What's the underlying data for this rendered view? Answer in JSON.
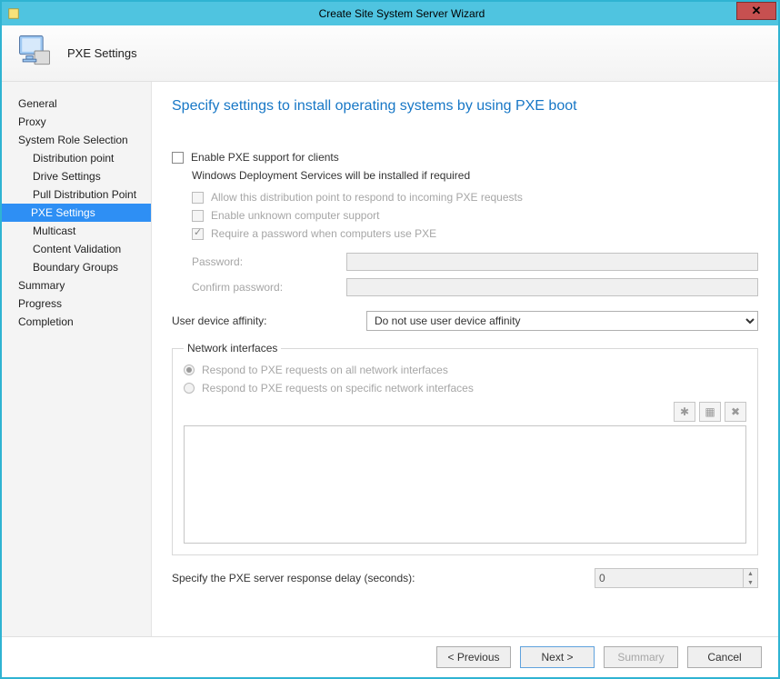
{
  "window": {
    "title": "Create Site System Server Wizard"
  },
  "header": {
    "page_label": "PXE Settings"
  },
  "sidebar": {
    "items": [
      {
        "label": "General"
      },
      {
        "label": "Proxy"
      },
      {
        "label": "System Role Selection"
      },
      {
        "label": "Distribution point",
        "sub": true
      },
      {
        "label": "Drive Settings",
        "sub": true
      },
      {
        "label": "Pull Distribution Point",
        "sub": true
      },
      {
        "label": "PXE Settings",
        "sub": true,
        "selected": true
      },
      {
        "label": "Multicast",
        "sub": true
      },
      {
        "label": "Content Validation",
        "sub": true
      },
      {
        "label": "Boundary Groups",
        "sub": true
      },
      {
        "label": "Summary"
      },
      {
        "label": "Progress"
      },
      {
        "label": "Completion"
      }
    ]
  },
  "main": {
    "page_title": "Specify settings to install operating systems by using PXE boot",
    "enable_pxe_label": "Enable PXE support for clients",
    "wds_note": "Windows Deployment Services will be installed if required",
    "allow_respond_label": "Allow this distribution point to respond to incoming PXE requests",
    "unknown_label": "Enable unknown computer support",
    "require_pw_label": "Require a password when computers use PXE",
    "password_label": "Password:",
    "confirm_label": "Confirm password:",
    "uda_label": "User device affinity:",
    "uda_value": "Do not use user device affinity",
    "net_legend": "Network interfaces",
    "net_all_label": "Respond to PXE requests on all network interfaces",
    "net_specific_label": "Respond to PXE requests on specific network interfaces",
    "delay_label": "Specify the PXE server response delay (seconds):",
    "delay_value": "0"
  },
  "footer": {
    "previous": "< Previous",
    "next": "Next >",
    "summary": "Summary",
    "cancel": "Cancel"
  }
}
